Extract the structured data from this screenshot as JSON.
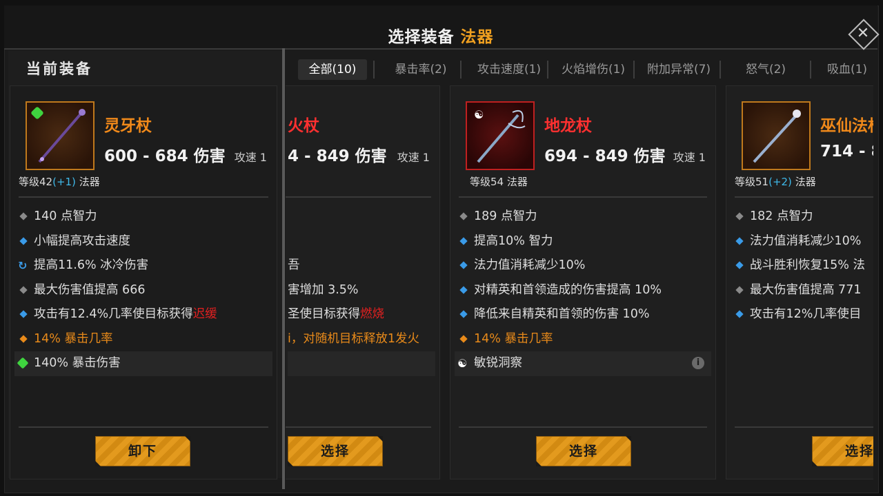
{
  "header": {
    "title": "选择装备",
    "title_accent": "法器",
    "close_icon": "close-icon"
  },
  "left": {
    "title": "当前装备",
    "item": {
      "name": "灵牙杖",
      "damage": "600 - 684 伤害",
      "speed": "攻速 1",
      "level_prefix": "等级42",
      "level_plus": "(+1)",
      "level_suffix": " 法器",
      "stats": [
        {
          "bullet": "grey",
          "text": "140 点智力"
        },
        {
          "bullet": "blue",
          "text": "小幅提高攻击速度"
        },
        {
          "bullet": "cycle",
          "text": "提高11.6% 冰冷伤害"
        },
        {
          "bullet": "grey",
          "text": "最大伤害值提高 666"
        },
        {
          "bullet": "blue",
          "text": "攻击有12.4%几率使目标获得",
          "tail": "迟缓"
        },
        {
          "bullet": "orange",
          "text": "14% 暴击几率"
        },
        {
          "bullet": "gem",
          "text": "140% 暴击伤害"
        }
      ],
      "button": "卸下"
    }
  },
  "tabs": [
    {
      "label": "全部(10)",
      "active": true
    },
    {
      "label": "暴击率(2)"
    },
    {
      "label": "攻击速度(1)"
    },
    {
      "label": "火焰增伤(1)"
    },
    {
      "label": "附加异常(7)"
    },
    {
      "label": "怒气(2)"
    },
    {
      "label": "吸血(1)"
    }
  ],
  "cards": [
    {
      "name": "火杖",
      "damage": "4 - 849 伤害",
      "speed": "攻速 1",
      "stats": [
        {
          "text": ""
        },
        {
          "text": ""
        },
        {
          "text": "吾"
        },
        {
          "text": "害增加 3.5%"
        },
        {
          "text": "圣使目标获得",
          "tail": "燃烧"
        },
        {
          "text": "i，对随机目标释放1发火"
        }
      ],
      "button": "选择"
    },
    {
      "name": "地龙杖",
      "damage": "694 - 849 伤害",
      "speed": "攻速 1",
      "level": "等级54 法器",
      "stats": [
        {
          "bullet": "grey",
          "text": "189 点智力"
        },
        {
          "bullet": "blue",
          "text": "提高10% 智力"
        },
        {
          "bullet": "blue",
          "text": "法力值消耗减少10%"
        },
        {
          "bullet": "blue",
          "text": "对精英和首领造成的伤害提高 10%"
        },
        {
          "bullet": "blue",
          "text": "降低来自精英和首领的伤害 10%"
        },
        {
          "bullet": "orange",
          "text": "14% 暴击几率"
        },
        {
          "bullet": "yinyang",
          "text": "敏锐洞察"
        }
      ],
      "info": "i",
      "button": "选择"
    },
    {
      "name": "巫仙法杖",
      "damage": "714 - 8",
      "level_prefix": "等级51",
      "level_plus": "(+2)",
      "level_suffix": " 法器",
      "stats": [
        {
          "bullet": "grey",
          "text": "182 点智力"
        },
        {
          "bullet": "blue",
          "text": "法力值消耗减少10%"
        },
        {
          "bullet": "blue",
          "text": "战斗胜利恢复15% 法"
        },
        {
          "bullet": "grey",
          "text": "最大伤害值提高 771"
        },
        {
          "bullet": "blue",
          "text": "攻击有12%几率使目"
        }
      ],
      "button": "选择"
    }
  ]
}
